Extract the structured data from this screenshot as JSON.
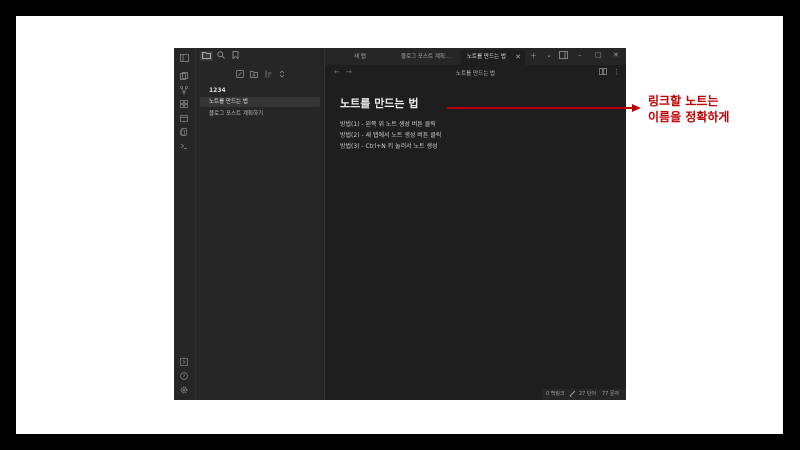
{
  "window": {
    "tabs": [
      {
        "label": "새 탭"
      },
      {
        "label": "블로그 포스트 계획..."
      },
      {
        "label": "노트를 만드는 법"
      }
    ]
  },
  "sidebar": {
    "vault_name": "1234",
    "files": [
      {
        "label": "노트를 만드는 법",
        "active": true
      },
      {
        "label": "블로그 포스트 계획하기",
        "active": false
      }
    ]
  },
  "view": {
    "title": "노트를 만드는 법",
    "back_icon": "←",
    "forward_icon": "→"
  },
  "note": {
    "heading": "노트를 만드는 법",
    "lines": [
      "방법(1) - 왼쪽 위 노트 생성 버튼 클릭",
      "방법(2) - 새 탭에서 노트 생성 버튼 클릭",
      "방법(3) - Ctrl+N 키 눌러서 노트 생성"
    ]
  },
  "status": {
    "backlinks": "0 백링크",
    "words": "27 단어",
    "chars": "77 문자"
  },
  "callout": {
    "line1": "링크할 노트는",
    "line2": "이름을 정확하게"
  },
  "colors": {
    "accent_red": "#c00000",
    "app_bg": "#1e1e1e",
    "sidebar_bg": "#262626"
  }
}
